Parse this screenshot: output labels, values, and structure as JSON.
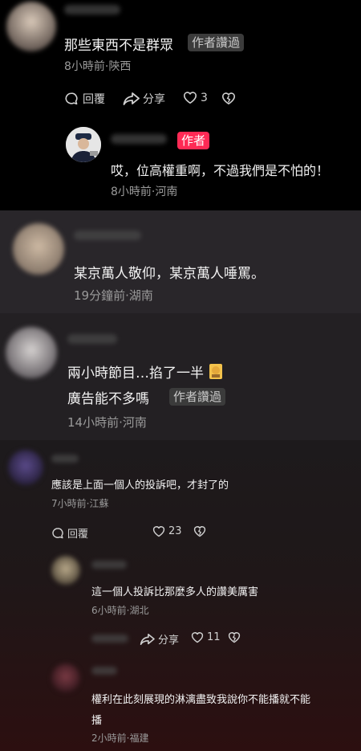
{
  "colors": {
    "author_badge": "#ff2a55",
    "reply_badge_bg": "#3b3b3b",
    "meta_gray": "#9a9a9a"
  },
  "comments": {
    "c1": {
      "text": "那些東西不是群眾",
      "badge": "作者讚過",
      "meta": "8小時前·陝西",
      "actions": {
        "reply": "回覆",
        "share": "分享",
        "likes": "3"
      },
      "reply": {
        "badge": "作者",
        "text": "哎，位高權重啊，不過我們是不怕的！",
        "meta": "8小時前·河南"
      }
    },
    "c2": {
      "text": "某京萬人敬仰，某京萬人唾罵。",
      "meta": "19分鐘前·湖南"
    },
    "c3": {
      "line1": "兩小時節目…掐了一半",
      "line2": "廣告能不多嗎",
      "badge": "作者讚過",
      "meta": "14小時前·河南"
    },
    "c4": {
      "text": "應該是上面一個人的投訴吧，才封了的",
      "meta": "7小時前·江蘇",
      "actions": {
        "reply": "回覆",
        "likes": "23"
      },
      "replies": [
        {
          "text": "這一個人投訴比那麼多人的讚美厲害",
          "meta": "6小時前·湖北",
          "actions": {
            "share": "分享",
            "likes": "11"
          }
        },
        {
          "line1": "權利在此刻展現的淋漓盡致我說你不能播就不能",
          "line2": "播",
          "meta": "2小時前·福建"
        }
      ]
    }
  }
}
